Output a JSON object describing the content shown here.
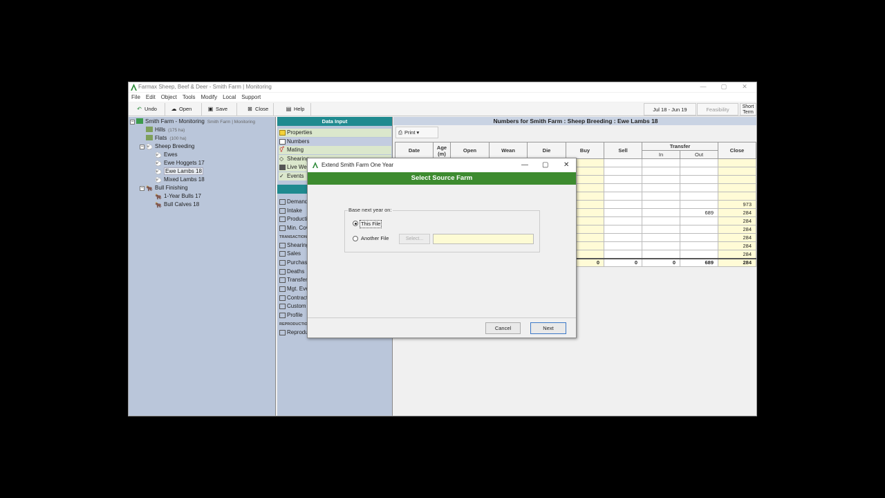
{
  "app": {
    "title": "Farmax Sheep, Beef & Deer - Smith Farm | Monitoring",
    "window_controls": [
      "—",
      "▢",
      "✕"
    ]
  },
  "menu": [
    "File",
    "Edit",
    "Object",
    "Tools",
    "Modify",
    "Local",
    "Support"
  ],
  "toolbar": {
    "undo": "Undo",
    "open": "Open",
    "save": "Save",
    "close": "Close",
    "help": "Help",
    "period": "Jul 18 - Jun 19",
    "feasibility": "Feasibility",
    "short_term_1": "Short",
    "short_term_2": "Term"
  },
  "tree": {
    "root": "Smith Farm - Monitoring",
    "root_sub": "Smith Farm | Monitoring",
    "hills": "Hills",
    "hills_area": "(175 ha)",
    "flats": "Flats",
    "flats_area": "(100 ha)",
    "sheep_breeding": "Sheep Breeding",
    "ewes": "Ewes",
    "ewe_hoggets": "Ewe Hoggets 17",
    "ewe_lambs": "Ewe Lambs 18",
    "mixed_lambs": "Mixed Lambs 18",
    "bull_finishing": "Bull Finishing",
    "one_year_bulls": "1-Year Bulls 17",
    "bull_calves": "Bull Calves 18"
  },
  "data_input": {
    "header": "Data Input",
    "items_top": [
      "Properties",
      "Numbers",
      "Mating",
      "Shearing",
      "Live Wei",
      "Events"
    ],
    "items_mid": [
      "Demand",
      "Intake",
      "Producti",
      "Min. Cov"
    ],
    "section_transactions": "TRANSACTIONS",
    "items_trans": [
      "Shearing",
      "Sales",
      "Purchas",
      "Deaths",
      "Transfer",
      "Mgt. Eve",
      "Contract",
      "Custom",
      "Profile"
    ],
    "section_reproduction": "REPRODUCTION",
    "items_repro": [
      "Reprodu"
    ]
  },
  "numbers": {
    "title": "Numbers for Smith Farm : Sheep Breeding : Ewe Lambs 18",
    "print": "Print",
    "columns": [
      "Date",
      "Age (m)",
      "Open",
      "Wean",
      "Die",
      "Buy",
      "Sell",
      "Transfer",
      "Close"
    ],
    "transfer_sub": [
      "In",
      "Out"
    ],
    "rows": [
      [
        "",
        "",
        "",
        "",
        "",
        "",
        "",
        "",
        "",
        ""
      ],
      [
        "",
        "",
        "",
        "",
        "",
        "",
        "",
        "",
        "",
        ""
      ],
      [
        "",
        "",
        "",
        "",
        "",
        "",
        "",
        "",
        "",
        ""
      ],
      [
        "",
        "",
        "",
        "",
        "",
        "",
        "",
        "",
        "",
        ""
      ],
      [
        "",
        "",
        "",
        "",
        "",
        "",
        "",
        "",
        "",
        ""
      ],
      [
        "",
        "",
        "",
        "",
        "",
        "",
        "",
        "",
        "",
        "973"
      ],
      [
        "",
        "",
        "",
        "",
        "",
        "",
        "",
        "",
        "689",
        "284"
      ],
      [
        "",
        "",
        "",
        "",
        "",
        "",
        "",
        "",
        "",
        "284"
      ],
      [
        "",
        "",
        "",
        "",
        "",
        "",
        "",
        "",
        "",
        "284"
      ],
      [
        "",
        "",
        "",
        "",
        "",
        "",
        "",
        "",
        "",
        "284"
      ],
      [
        "",
        "",
        "",
        "",
        "",
        "",
        "",
        "",
        "",
        "284"
      ],
      [
        "",
        "",
        "",
        "",
        "",
        "",
        "",
        "",
        "",
        "284"
      ]
    ],
    "totals": [
      "",
      "",
      "",
      "",
      "",
      "0",
      "0",
      "0",
      "689",
      "284"
    ]
  },
  "dialog": {
    "title": "Extend Smith Farm One Year",
    "banner": "Select Source Farm",
    "group_label": "Base next year on:",
    "option_this_file": "This File",
    "option_another_file": "Another File",
    "select_button": "Select...",
    "file_value": "",
    "cancel": "Cancel",
    "next": "Next"
  },
  "colors": {
    "teal_header": "#1f8a8f",
    "green_banner": "#3d8b2f",
    "panel_bg": "#bac6da",
    "input_yellow": "#fffbd6"
  }
}
